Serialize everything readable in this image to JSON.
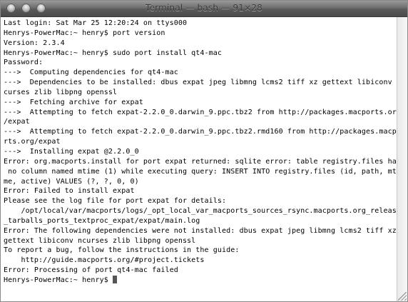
{
  "window": {
    "title": "Terminal — bash — 91×28"
  },
  "terminal": {
    "lines": [
      "Last login: Sat Mar 25 12:20:24 on ttys000",
      "Henrys-PowerMac:~ henry$ port version",
      "Version: 2.3.4",
      "Henrys-PowerMac:~ henry$ sudo port install qt4-mac",
      "Password:",
      "--->  Computing dependencies for qt4-mac",
      "--->  Dependencies to be installed: dbus expat jpeg libmng lcms2 tiff xz gettext libiconv n",
      "curses zlib libpng openssl",
      "--->  Fetching archive for expat",
      "--->  Attempting to fetch expat-2.2.0_0.darwin_9.ppc.tbz2 from http://packages.macports.org",
      "/expat",
      "--->  Attempting to fetch expat-2.2.0_0.darwin_9.ppc.tbz2.rmd160 from http://packages.macpo",
      "rts.org/expat",
      "--->  Installing expat @2.2.0_0",
      "Error: org.macports.install for port expat returned: sqlite error: table registry.files has",
      " no column named mtime (1) while executing query: INSERT INTO registry.files (id, path, mti",
      "me, active) VALUES (?, ?, 0, 0)",
      "Error: Failed to install expat",
      "Please see the log file for port expat for details:",
      "    /opt/local/var/macports/logs/_opt_local_var_macports_sources_rsync.macports.org_release",
      "_tarballs_ports_textproc_expat/expat/main.log",
      "Error: The following dependencies were not installed: dbus expat jpeg libmng lcms2 tiff xz",
      "gettext libiconv ncurses zlib libpng openssl",
      "To report a bug, follow the instructions in the guide:",
      "    http://guide.macports.org/#project.tickets",
      "Error: Processing of port qt4-mac failed"
    ],
    "prompt": "Henrys-PowerMac:~ henry$ "
  }
}
